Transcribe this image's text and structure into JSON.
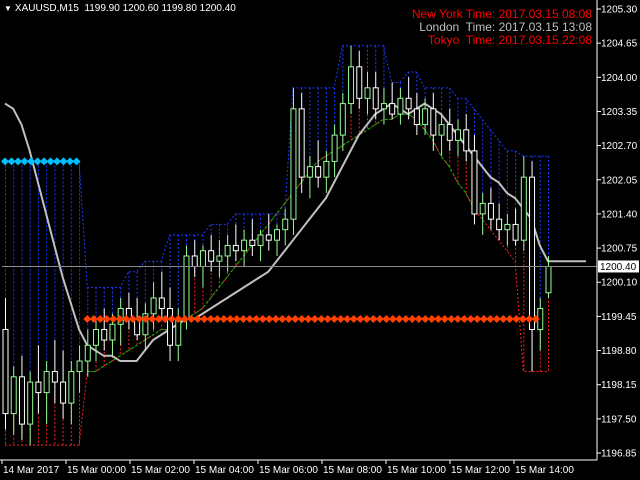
{
  "header": {
    "symbol": "XAUUSD,M15",
    "ohlc": "1199.90 1200.60 1199.80 1200.40"
  },
  "clocks": [
    {
      "label": "New York Time: 2017.03.15 08:08",
      "color": "#ff0000"
    },
    {
      "label": "London  Time: 2017.03.15 13:08",
      "color": "#c0c0c0"
    },
    {
      "label": "Tokyo  Time: 2017.03.15 22:08",
      "color": "#ff0000"
    }
  ],
  "current_price": "1200.40",
  "colors": {
    "background": "#000000",
    "bull": "#98fb98",
    "bear": "#ffffff",
    "upper_band": "#1e3cff",
    "lower_band": "#ff2020",
    "ma": "#c0c0c0",
    "green_line": "#00c000",
    "blue_level": "#00bfff",
    "orange_level": "#ff4000"
  },
  "chart_data": {
    "type": "candlestick",
    "symbol": "XAUUSD",
    "timeframe": "M15",
    "ylim": [
      1196.7,
      1205.4
    ],
    "y_ticks": [
      "1205.30",
      "1204.65",
      "1204.00",
      "1203.35",
      "1202.70",
      "1202.05",
      "1201.40",
      "1200.75",
      "1200.10",
      "1199.45",
      "1198.80",
      "1198.15",
      "1197.50",
      "1196.85"
    ],
    "x_ticks": [
      "14 Mar 2017",
      "15 Mar 00:00",
      "15 Mar 02:00",
      "15 Mar 04:00",
      "15 Mar 06:00",
      "15 Mar 08:00",
      "15 Mar 10:00",
      "15 Mar 12:00",
      "15 Mar 14:00"
    ],
    "candles": [
      [
        1199.2,
        1199.8,
        1197.3,
        1197.6
      ],
      [
        1197.6,
        1198.5,
        1197.2,
        1198.3
      ],
      [
        1198.3,
        1198.7,
        1197.1,
        1197.4
      ],
      [
        1197.4,
        1198.4,
        1197.0,
        1198.2
      ],
      [
        1198.2,
        1198.9,
        1197.6,
        1198.0
      ],
      [
        1198.0,
        1198.6,
        1197.4,
        1198.4
      ],
      [
        1198.4,
        1199.0,
        1197.8,
        1198.2
      ],
      [
        1198.2,
        1198.8,
        1197.5,
        1197.8
      ],
      [
        1197.8,
        1198.6,
        1197.4,
        1198.4
      ],
      [
        1198.4,
        1198.9,
        1198.0,
        1198.6
      ],
      [
        1198.6,
        1199.2,
        1198.3,
        1198.9
      ],
      [
        1198.9,
        1199.4,
        1198.6,
        1199.2
      ],
      [
        1199.2,
        1199.6,
        1198.8,
        1199.0
      ],
      [
        1199.0,
        1199.5,
        1198.7,
        1199.3
      ],
      [
        1199.3,
        1199.8,
        1198.9,
        1199.6
      ],
      [
        1199.6,
        1199.9,
        1199.2,
        1199.4
      ],
      [
        1199.4,
        1199.8,
        1199.0,
        1199.1
      ],
      [
        1199.1,
        1199.7,
        1198.8,
        1199.5
      ],
      [
        1199.5,
        1200.1,
        1199.2,
        1199.8
      ],
      [
        1199.8,
        1200.3,
        1199.4,
        1199.6
      ],
      [
        1199.6,
        1200.0,
        1198.6,
        1198.9
      ],
      [
        1198.9,
        1199.6,
        1198.6,
        1199.4
      ],
      [
        1199.4,
        1200.8,
        1199.2,
        1200.6
      ],
      [
        1200.6,
        1200.9,
        1200.2,
        1200.4
      ],
      [
        1200.4,
        1200.8,
        1200.0,
        1200.7
      ],
      [
        1200.7,
        1201.0,
        1200.3,
        1200.5
      ],
      [
        1200.5,
        1200.9,
        1200.2,
        1200.6
      ],
      [
        1200.6,
        1201.0,
        1200.3,
        1200.8
      ],
      [
        1200.8,
        1201.2,
        1200.5,
        1200.7
      ],
      [
        1200.7,
        1201.1,
        1200.4,
        1200.9
      ],
      [
        1200.9,
        1201.3,
        1200.6,
        1200.8
      ],
      [
        1200.8,
        1201.1,
        1200.5,
        1201.0
      ],
      [
        1201.0,
        1201.4,
        1200.7,
        1200.9
      ],
      [
        1200.9,
        1201.2,
        1200.6,
        1201.1
      ],
      [
        1201.1,
        1201.5,
        1200.8,
        1201.3
      ],
      [
        1201.3,
        1203.8,
        1201.0,
        1203.4
      ],
      [
        1203.4,
        1203.7,
        1201.8,
        1202.1
      ],
      [
        1202.1,
        1202.5,
        1201.7,
        1202.3
      ],
      [
        1202.3,
        1202.8,
        1201.9,
        1202.1
      ],
      [
        1202.1,
        1202.6,
        1201.8,
        1202.4
      ],
      [
        1202.4,
        1203.1,
        1202.1,
        1202.9
      ],
      [
        1202.9,
        1203.7,
        1202.6,
        1203.5
      ],
      [
        1203.5,
        1204.6,
        1203.3,
        1204.2
      ],
      [
        1204.2,
        1204.5,
        1203.4,
        1203.6
      ],
      [
        1203.6,
        1204.1,
        1203.3,
        1203.8
      ],
      [
        1203.8,
        1204.1,
        1203.2,
        1203.4
      ],
      [
        1203.4,
        1203.8,
        1203.1,
        1203.5
      ],
      [
        1203.5,
        1203.9,
        1203.2,
        1203.3
      ],
      [
        1203.3,
        1203.8,
        1203.1,
        1203.6
      ],
      [
        1203.6,
        1204.0,
        1203.2,
        1203.4
      ],
      [
        1203.4,
        1203.7,
        1202.9,
        1203.1
      ],
      [
        1203.1,
        1203.6,
        1202.9,
        1203.4
      ],
      [
        1203.4,
        1203.7,
        1202.6,
        1202.9
      ],
      [
        1202.9,
        1203.3,
        1202.5,
        1203.1
      ],
      [
        1203.1,
        1203.4,
        1202.6,
        1202.8
      ],
      [
        1202.8,
        1203.2,
        1202.5,
        1203.0
      ],
      [
        1203.0,
        1203.3,
        1202.4,
        1202.6
      ],
      [
        1202.6,
        1202.9,
        1201.2,
        1201.4
      ],
      [
        1201.4,
        1201.8,
        1201.0,
        1201.6
      ],
      [
        1201.6,
        1201.9,
        1201.1,
        1201.3
      ],
      [
        1201.3,
        1201.6,
        1200.9,
        1201.1
      ],
      [
        1201.1,
        1201.4,
        1200.8,
        1201.2
      ],
      [
        1201.2,
        1201.5,
        1200.8,
        1200.9
      ],
      [
        1200.9,
        1202.5,
        1200.7,
        1202.1
      ],
      [
        1202.1,
        1202.4,
        1198.4,
        1199.2
      ],
      [
        1199.2,
        1199.8,
        1198.8,
        1199.6
      ],
      [
        1199.9,
        1200.6,
        1199.8,
        1200.4
      ]
    ],
    "upper_band": [
      1202.4,
      1202.4,
      1202.4,
      1202.4,
      1202.4,
      1202.4,
      1202.4,
      1202.4,
      1202.4,
      1202.4,
      1200.0,
      1200.0,
      1200.0,
      1200.0,
      1200.0,
      1200.3,
      1200.3,
      1200.5,
      1200.5,
      1200.5,
      1201.0,
      1201.0,
      1201.0,
      1201.0,
      1201.0,
      1201.2,
      1201.2,
      1201.2,
      1201.4,
      1201.4,
      1201.4,
      1201.4,
      1201.4,
      1201.4,
      1201.4,
      1203.8,
      1203.8,
      1203.8,
      1203.8,
      1203.8,
      1203.8,
      1204.6,
      1204.6,
      1204.6,
      1204.6,
      1204.6,
      1204.6,
      1203.9,
      1203.9,
      1204.1,
      1204.1,
      1203.8,
      1203.8,
      1203.8,
      1203.8,
      1203.6,
      1203.6,
      1203.4,
      1203.2,
      1203.0,
      1202.8,
      1202.6,
      1202.6,
      1202.5,
      1202.5,
      1202.5,
      1202.5
    ],
    "lower_band": [
      1197.0,
      1197.0,
      1197.0,
      1197.0,
      1197.0,
      1197.0,
      1197.0,
      1197.0,
      1197.0,
      1197.0,
      1198.4,
      1198.4,
      1198.5,
      1198.6,
      1198.7,
      1198.8,
      1198.9,
      1199.0,
      1199.1,
      1199.2,
      1199.2,
      1199.3,
      1199.4,
      1199.5,
      1199.6,
      1199.8,
      1200.0,
      1200.2,
      1200.4,
      1200.6,
      1200.8,
      1201.0,
      1201.2,
      1201.4,
      1201.6,
      1201.8,
      1202.0,
      1202.2,
      1202.4,
      1202.5,
      1202.6,
      1202.7,
      1202.8,
      1202.9,
      1203.0,
      1203.1,
      1203.2,
      1203.2,
      1203.3,
      1203.3,
      1203.2,
      1203.0,
      1202.8,
      1202.5,
      1202.3,
      1202.0,
      1201.8,
      1201.5,
      1201.3,
      1201.1,
      1200.9,
      1200.7,
      1200.5,
      1198.4,
      1198.4,
      1198.4,
      1198.4
    ],
    "ma_line": [
      1203.5,
      1203.4,
      1203.1,
      1202.6,
      1202.0,
      1201.4,
      1200.8,
      1200.2,
      1199.7,
      1199.2,
      1198.9,
      1198.8,
      1198.7,
      1198.7,
      1198.6,
      1198.6,
      1198.6,
      1198.8,
      1199.0,
      1199.1,
      1199.2,
      1199.3,
      1199.4,
      1199.4,
      1199.5,
      1199.6,
      1199.7,
      1199.8,
      1199.9,
      1200.0,
      1200.1,
      1200.2,
      1200.3,
      1200.5,
      1200.7,
      1200.9,
      1201.1,
      1201.3,
      1201.5,
      1201.7,
      1202.0,
      1202.3,
      1202.6,
      1202.9,
      1203.1,
      1203.3,
      1203.4,
      1203.5,
      1203.4,
      1203.3,
      1203.4,
      1203.5,
      1203.4,
      1203.3,
      1203.1,
      1202.9,
      1202.7,
      1202.5,
      1202.3,
      1202.1,
      1202.0,
      1201.8,
      1201.7,
      1201.5,
      1201.3,
      1200.8,
      1200.5
    ],
    "blue_level": {
      "value": 1202.4,
      "from_index": 0,
      "to_index": 9
    },
    "orange_level": {
      "value": 1199.4,
      "from_index": 10,
      "to_index": 65
    },
    "current_price": 1200.4
  }
}
